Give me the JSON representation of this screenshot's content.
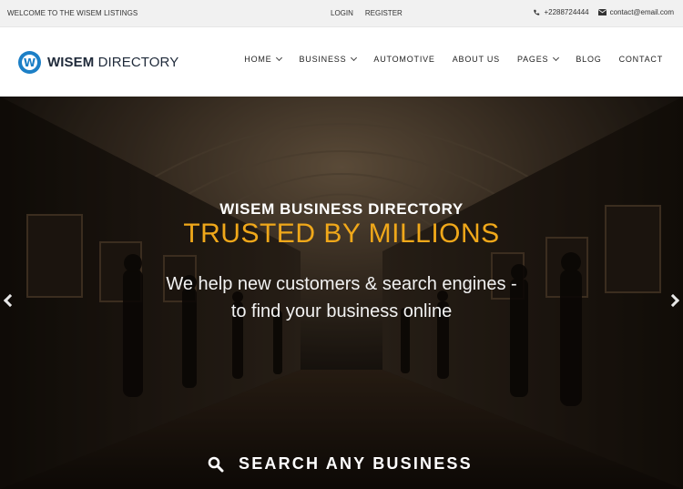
{
  "topbar": {
    "welcome": "WELCOME TO THE WISEM LISTINGS",
    "login": "LOGIN",
    "register": "REGISTER",
    "phone": "+2288724444",
    "email": "contact@email.com",
    "phone_icon": "phone-icon",
    "email_icon": "envelope-icon"
  },
  "logo": {
    "mark": "W",
    "name_bold": "WISEM",
    "name_rest": " DIRECTORY",
    "color": "#1c7fc6"
  },
  "nav": {
    "items": [
      {
        "label": "HOME",
        "dropdown": true
      },
      {
        "label": "BUSINESS",
        "dropdown": true
      },
      {
        "label": "AUTOMOTIVE",
        "dropdown": false
      },
      {
        "label": "ABOUT US",
        "dropdown": false
      },
      {
        "label": "PAGES",
        "dropdown": true
      },
      {
        "label": "BLOG",
        "dropdown": false
      },
      {
        "label": "CONTACT",
        "dropdown": false
      }
    ]
  },
  "hero": {
    "subtitle": "WISEM BUSINESS DIRECTORY",
    "title": "TRUSTED BY MILLIONS",
    "desc_line1": "We help new customers & search engines -",
    "desc_line2": "to find your business online",
    "accent": "#f0a81a",
    "search_label": "SEARCH ANY BUSINESS",
    "search_icon": "search-icon",
    "prev_icon": "chevron-left-icon",
    "next_icon": "chevron-right-icon"
  }
}
